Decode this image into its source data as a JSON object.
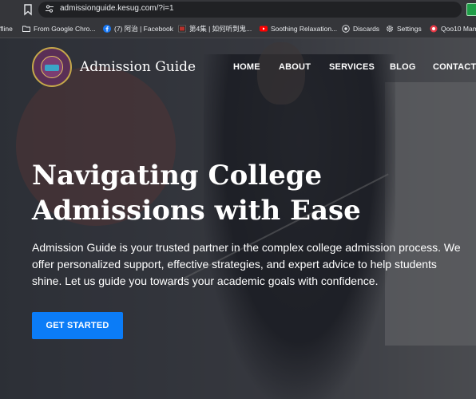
{
  "browser": {
    "url": "admissionguide.kesug.com/?i=1",
    "bookmarks": [
      {
        "label": "ffline",
        "icon": "none"
      },
      {
        "label": "From Google Chro...",
        "icon": "folder-icon"
      },
      {
        "label": "(7) 阿治 | Facebook",
        "icon": "facebook-icon"
      },
      {
        "label": "第4集 | 如何听到鬼...",
        "icon": "video-icon"
      },
      {
        "label": "Soothing Relaxation...",
        "icon": "youtube-icon"
      },
      {
        "label": "Discards",
        "icon": "globe-icon"
      },
      {
        "label": "Settings",
        "icon": "gear-icon"
      },
      {
        "label": "Qoo10 Mam",
        "icon": "qoo10-icon"
      }
    ]
  },
  "site": {
    "brand": "Admission Guide",
    "logo_text": "ADMISSION GUIDE",
    "nav": {
      "home": "HOME",
      "about": "ABOUT",
      "services": "SERVICES",
      "blog": "BLOG",
      "contact": "CONTACT"
    }
  },
  "hero": {
    "title": "Navigating College Admissions with Ease",
    "description": "Admission Guide is your trusted partner in the complex college admission process. We offer personalized support, effective strategies, and expert advice to help students shine. Let us guide you towards your academic goals with confidence.",
    "cta": "GET STARTED"
  },
  "colors": {
    "accent": "#0b7cf7",
    "chrome": "#35363a",
    "text": "#ffffff"
  }
}
